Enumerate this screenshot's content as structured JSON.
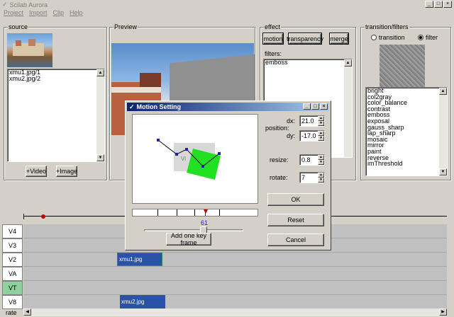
{
  "window": {
    "title": "Scilab Aurora",
    "minimize": "_",
    "maximize": "□",
    "close": "×"
  },
  "menu": [
    "Project",
    "Import",
    "Clip",
    "Help"
  ],
  "source": {
    "label": "source",
    "items": [
      "xmu1.jpg/1",
      "xmu2.jpg/2"
    ],
    "add_video": "+Video",
    "add_image": "+Image"
  },
  "preview": {
    "label": "Preview"
  },
  "effect": {
    "label": "effect",
    "buttons": {
      "motion": "motion",
      "transparency": "transparency",
      "merge": "merge"
    },
    "filters_label": "filters:",
    "filters": [
      "emboss"
    ]
  },
  "transition": {
    "label": "transition/filters",
    "option_transition": "transition",
    "option_filter": "filter",
    "selected": "filter",
    "list": [
      "bright",
      "col2gray",
      "color_balance",
      "contrast",
      "emboss",
      "exposal",
      "gauss_sharp",
      "lap_sharp",
      "mosaic",
      "mirror",
      "paint",
      "reverse",
      "imThreshold"
    ]
  },
  "timeline": {
    "tracks": [
      "V4",
      "V3",
      "V2",
      "VA",
      "VT",
      "V8"
    ],
    "rate_label": "rate",
    "clips": [
      {
        "track": "V2",
        "label": "xmu1.jpg"
      },
      {
        "track": "V8",
        "label": "xmu2.jpg"
      }
    ]
  },
  "dialog": {
    "title": "Motion Setting",
    "position_label": "position:",
    "dx_label": "dx:",
    "dx": "21.0",
    "dy_label": "dy:",
    "dy": "-17.0",
    "resize_label": "resize:",
    "resize": "0.8",
    "rotate_label": "rotate:",
    "rotate": "7",
    "canvas_text": "Vi",
    "slider_value": "61",
    "slider_percent": 61,
    "add_keyframe": "Add one key frame",
    "ok": "OK",
    "reset": "Reset",
    "cancel": "Cancel",
    "title_buttons": {
      "minimize": "_",
      "maximize": "□",
      "close": "×"
    }
  },
  "colors": {
    "dialog_title_start": "#0a246a",
    "dialog_title_end": "#a6caf0",
    "motion_shape": "#22e022",
    "clip_fill": "#2a52a6",
    "vt_track": "#8fd19e"
  }
}
